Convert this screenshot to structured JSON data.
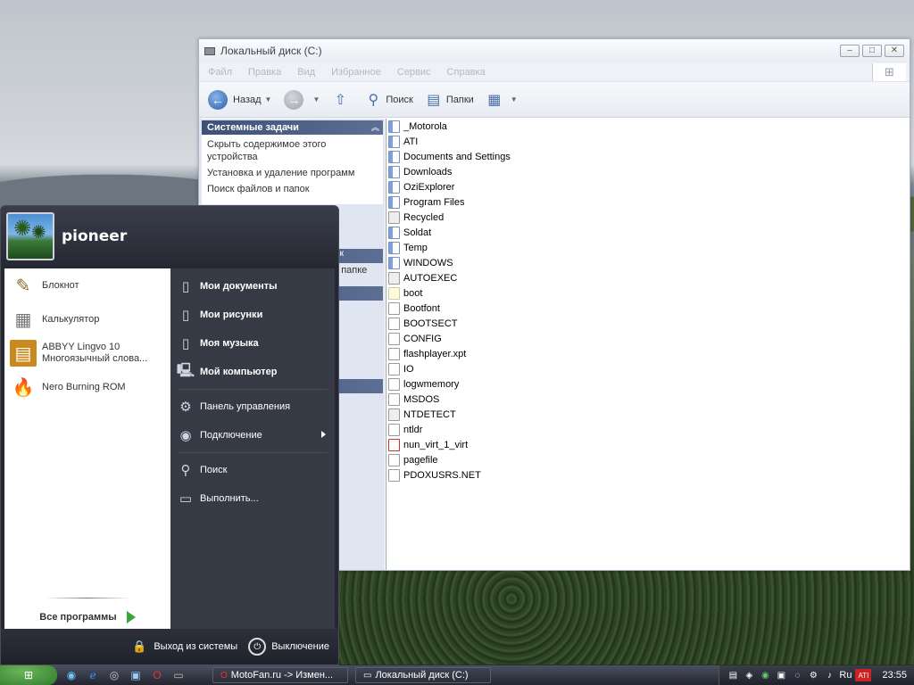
{
  "window": {
    "title": "Локальный диск (C:)",
    "menu": [
      "Файл",
      "Правка",
      "Вид",
      "Избранное",
      "Сервис",
      "Справка"
    ],
    "toolbar": {
      "back_label": "Назад",
      "search_label": "Поиск",
      "folders_label": "Папки"
    },
    "tasks": {
      "header": "Системные задачи",
      "items": [
        "Скрыть содержимое этого устройства",
        "Установка и удаление программ",
        "Поиск файлов и папок"
      ],
      "hidden_fragments": [
        "к",
        "й папке"
      ]
    },
    "files": [
      {
        "name": "_Motorola",
        "type": "folder"
      },
      {
        "name": "ATI",
        "type": "folder"
      },
      {
        "name": "Documents and Settings",
        "type": "folder"
      },
      {
        "name": "Downloads",
        "type": "folder"
      },
      {
        "name": "OziExplorer",
        "type": "folder"
      },
      {
        "name": "Program Files",
        "type": "folder"
      },
      {
        "name": "Recycled",
        "type": "sys"
      },
      {
        "name": "Soldat",
        "type": "folder"
      },
      {
        "name": "Temp",
        "type": "folder"
      },
      {
        "name": "WINDOWS",
        "type": "folder"
      },
      {
        "name": "AUTOEXEC",
        "type": "sys"
      },
      {
        "name": "boot",
        "type": "bat"
      },
      {
        "name": "Bootfont",
        "type": "file"
      },
      {
        "name": "BOOTSECT",
        "type": "file"
      },
      {
        "name": "CONFIG",
        "type": "file"
      },
      {
        "name": "flashplayer.xpt",
        "type": "file"
      },
      {
        "name": "IO",
        "type": "file"
      },
      {
        "name": "logwmemory",
        "type": "file"
      },
      {
        "name": "MSDOS",
        "type": "file"
      },
      {
        "name": "NTDETECT",
        "type": "sys"
      },
      {
        "name": "ntldr",
        "type": "file"
      },
      {
        "name": "nun_virt_1_virt",
        "type": "exe"
      },
      {
        "name": "pagefile",
        "type": "file"
      },
      {
        "name": "PDOXUSRS.NET",
        "type": "file"
      }
    ]
  },
  "startmenu": {
    "username": "pioneer",
    "pinned": [
      {
        "label": "Блокнот",
        "icon": "notepad-icon"
      },
      {
        "label": "Калькулятор",
        "icon": "calculator-icon"
      },
      {
        "label": "ABBYY Lingvo 10",
        "label2": "Многоязычный слова...",
        "icon": "lingvo-icon"
      },
      {
        "label": "Nero Burning ROM",
        "icon": "nero-icon"
      }
    ],
    "all_programs": "Все программы",
    "right": [
      {
        "label": "Мои документы",
        "bold": true
      },
      {
        "label": "Мои рисунки",
        "bold": true
      },
      {
        "label": "Моя музыка",
        "bold": true
      },
      {
        "label": "Мой компьютер",
        "bold": true
      },
      {
        "label": "Панель управления"
      },
      {
        "label": "Подключение",
        "submenu": true
      },
      {
        "label": "Поиск"
      },
      {
        "label": "Выполнить..."
      }
    ],
    "logoff": "Выход из системы",
    "shutdown": "Выключение"
  },
  "taskbar": {
    "tasks": [
      "MotoFan.ru -> Измен...",
      "Локальный диск (C:)"
    ],
    "lang": "Ru",
    "clock": "23:55"
  }
}
